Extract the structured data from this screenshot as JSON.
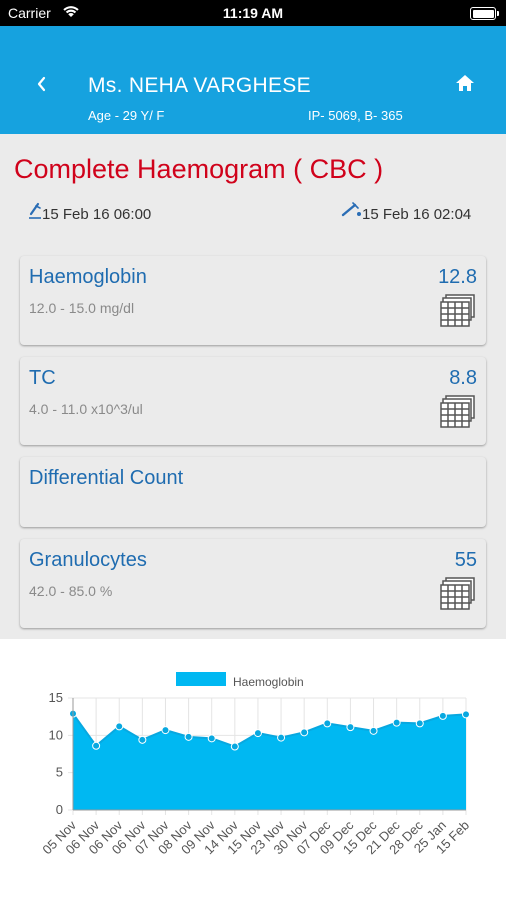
{
  "status_bar": {
    "carrier": "Carrier",
    "time": "11:19 AM"
  },
  "header": {
    "back_icon": "chevron-left-icon",
    "patient_name": "Ms. NEHA VARGHESE",
    "age": "Age - 29 Y/ F",
    "ip": "IP- 5069, B- 365",
    "home_icon": "home-icon",
    "color": "#16a2df"
  },
  "test": {
    "title": "Complete Haemogram ( CBC )",
    "collected": "15 Feb 16 06:00",
    "reported": "15 Feb 16 02:04",
    "title_color": "#d0021b"
  },
  "results": [
    {
      "name": "Haemoglobin",
      "range": "12.0 - 15.0 mg/dl",
      "value": "12.8"
    },
    {
      "name": "TC",
      "range": "4.0 - 11.0 x10^3/ul",
      "value": "8.8"
    },
    {
      "name": "Differential Count",
      "range": "",
      "value": ""
    },
    {
      "name": "Granulocytes",
      "range": "42.0 - 85.0 %",
      "value": "55"
    }
  ],
  "chart_data": {
    "type": "area",
    "series": [
      {
        "name": "Haemoglobin",
        "values": [
          12.9,
          8.6,
          11.2,
          9.4,
          10.7,
          9.8,
          9.6,
          8.5,
          10.3,
          9.7,
          10.4,
          11.6,
          11.1,
          10.6,
          11.7,
          11.6,
          12.6,
          12.8
        ]
      }
    ],
    "categories": [
      "05 Nov",
      "06 Nov",
      "06 Nov",
      "06 Nov",
      "07 Nov",
      "08 Nov",
      "09 Nov",
      "14 Nov",
      "15 Nov",
      "23 Nov",
      "30 Nov",
      "07 Dec",
      "09 Dec",
      "15 Dec",
      "21 Dec",
      "28 Dec",
      "25 Jan",
      "15 Feb"
    ],
    "y_ticks": [
      "0",
      "5",
      "10",
      "15"
    ],
    "ylim": [
      0,
      15
    ],
    "grid": true,
    "legend_position": "top-center",
    "color": "#00b8f2"
  }
}
